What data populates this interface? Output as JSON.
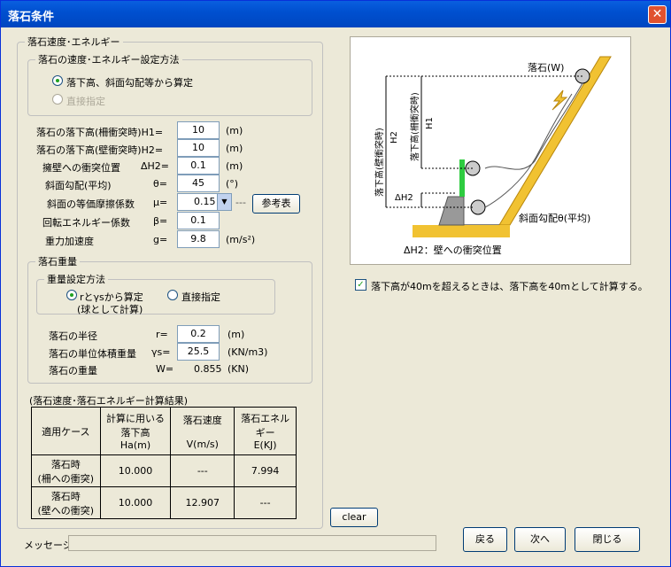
{
  "window": {
    "title": "落石条件",
    "close_icon": "close-icon"
  },
  "speed_group": {
    "legend": "落石速度･エネルギー",
    "method_legend": "落石の速度･エネルギー設定方法",
    "option_auto": "落下高、斜面勾配等から算定",
    "option_direct": "直接指定",
    "selected": "auto"
  },
  "fields": {
    "h1": {
      "label": "落石の落下高(柵衝突時)H1=",
      "value": "10",
      "unit": "(m)"
    },
    "h2": {
      "label": "落石の落下高(壁衝突時)H2=",
      "value": "10",
      "unit": "(m)"
    },
    "dh2": {
      "label": "擁壁への衝突位置",
      "symbol": "ΔH2=",
      "value": "0.1",
      "unit": "(m)"
    },
    "theta": {
      "label": "斜面勾配(平均)",
      "symbol": "θ=",
      "value": "45",
      "unit": "(°)"
    },
    "mu": {
      "label": "斜面の等価摩擦係数",
      "symbol": "μ=",
      "value": "0.15"
    },
    "beta": {
      "label": "回転エネルギー係数",
      "symbol": "β=",
      "value": "0.1"
    },
    "g": {
      "label": "重力加速度",
      "symbol": "g=",
      "value": "9.8",
      "unit": "(m/s²)"
    }
  },
  "reference_button": "参考表",
  "weight_group": {
    "legend": "落石重量",
    "method_legend": "重量設定方法",
    "option_calc": "rとγsから算定",
    "option_calc_sub": "(球として計算)",
    "option_direct": "直接指定",
    "selected": "calc",
    "radius": {
      "label": "落石の半径",
      "symbol": "r=",
      "value": "0.2",
      "unit": "(m)"
    },
    "unit_weight": {
      "label": "落石の単位体積重量",
      "symbol": "γs=",
      "value": "25.5",
      "unit": "(KN/m3)"
    },
    "weight": {
      "label": "落石の重量",
      "symbol": "W=",
      "value": "0.855",
      "unit": "(KN)"
    }
  },
  "results": {
    "caption": "(落石速度･落石エネルギー計算結果)",
    "headers": {
      "case": "適用ケース",
      "height_a": "計算に用いる",
      "height_b": "落下高",
      "height_c": "Ha(m)",
      "velocity_a": "落石速度",
      "velocity_b": "V(m/s)",
      "energy_a": "落石エネル",
      "energy_b": "ギー",
      "energy_c": "E(KJ)"
    },
    "rows": [
      {
        "case_a": "落石時",
        "case_b": "(柵への衝突)",
        "height": "10.000",
        "velocity": "---",
        "energy": "7.994"
      },
      {
        "case_a": "落石時",
        "case_b": "(壁への衝突)",
        "height": "10.000",
        "velocity": "12.907",
        "energy": "---"
      }
    ]
  },
  "diagram": {
    "rock_label": "落石(W)",
    "h1_label": "落下高(柵衝突時)",
    "h1_sym": "H1",
    "h2_label": "落下高(壁衝突時)",
    "h2_sym": "H2",
    "dh2_sym": "ΔH2",
    "slope_label": "斜面勾配θ(平均)",
    "dh2_caption": "ΔH2：壁への衝突位置"
  },
  "limit_checkbox": {
    "label": "落下高が40mを超えるときは、落下高を40mとして計算する。",
    "checked": true
  },
  "clear_button": "clear",
  "message_label": "メッセージ:",
  "buttons": {
    "back": "戻る",
    "next": "次へ",
    "close": "閉じる"
  }
}
